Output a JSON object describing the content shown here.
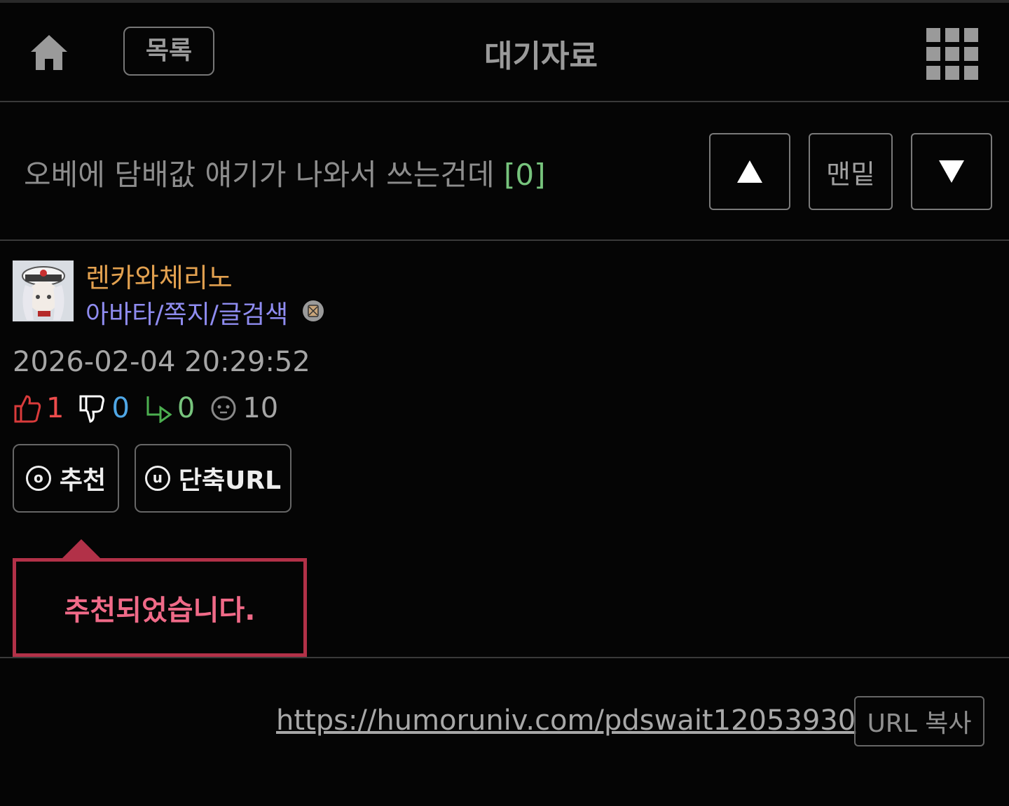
{
  "header": {
    "home_icon": "home-icon",
    "list_label": "목록",
    "title": "대기자료",
    "menu_icon": "grid-menu-icon"
  },
  "post": {
    "title": "오베에 담배값 얘기가 나와서 쓰는건데",
    "comment_count": "[0]",
    "nav": {
      "up_icon": "triangle-up-icon",
      "bottom_label": "맨밑",
      "down_icon": "triangle-down-icon"
    },
    "author": {
      "name": "렌카와체리노",
      "links": "아바타/쪽지/글검색"
    },
    "date": "2026-02-04 20:29:52",
    "stats": {
      "upvotes": "1",
      "downvotes": "0",
      "replies": "0",
      "views": "10"
    },
    "actions": {
      "recommend_label": "추천",
      "recommend_icon_glyph": "o",
      "shorturl_label": "단축URL",
      "shorturl_icon_glyph": "u"
    },
    "toast": "추천되었습니다.",
    "url": "https://humoruniv.com/pdswait12053930",
    "copy_label": "URL 복사"
  },
  "colors": {
    "accent_toast": "#b23148",
    "author_name": "#e2a150",
    "author_links": "#8f8cf0",
    "upvote": "#ee4c4c",
    "downvote": "#4fa7e6",
    "reply": "#77c47d"
  }
}
